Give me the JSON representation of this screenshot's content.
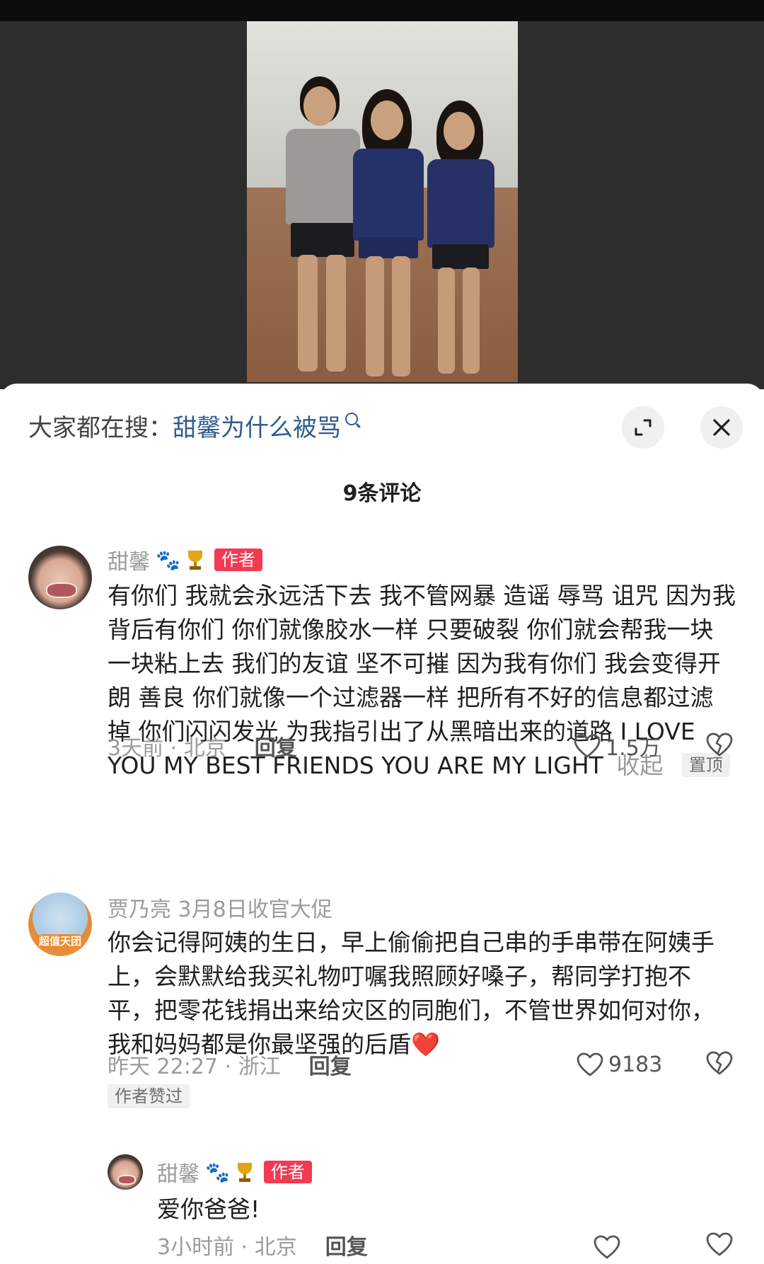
{
  "search": {
    "prefix": "大家都在搜：",
    "query": "甜馨为什么被骂"
  },
  "comment_count": "9条评论",
  "comments": [
    {
      "username": "甜馨",
      "paw": "🐾",
      "author_tag": "作者",
      "text": "有你们 我就会永远活下去 我不管网暴 造谣 辱骂 诅咒 因为我背后有你们 你们就像胶水一样 只要破裂 你们就会帮我一块一块粘上去 我们的友谊 坚不可摧 因为我有你们 我会变得开朗 善良 你们就像一个过滤器一样 把所有不好的信息都过滤掉 你们闪闪发光 为我指引出了从黑暗出来的道路 I LOVE YOU MY BEST FRIENDS YOU ARE MY LIGHT",
      "collapse": "收起",
      "pinned": "置顶",
      "time_location": "3天前 · 北京",
      "reply": "回复",
      "likes": "1.5万"
    },
    {
      "username": "贾乃亮 3月8日收官大促",
      "avatar_badge": "超值天团",
      "text": "你会记得阿姨的生日，早上偷偷把自己串的手串带在阿姨手上，会默默给我买礼物叮嘱我照顾好嗓子，帮同学打抱不平，把零花钱捐出来给灾区的同胞们，不管世界如何对你，我和妈妈都是你最坚强的后盾❤️",
      "time_location": "昨天 22:27 · 浙江",
      "reply": "回复",
      "likes": "9183",
      "liked_tag": "作者赞过"
    }
  ],
  "reply": {
    "username": "甜馨",
    "paw": "🐾",
    "author_tag": "作者",
    "text": "爱你爸爸!",
    "time_location": "3小时前 · 北京",
    "reply": "回复"
  },
  "colors": {
    "link": "#2f5d8c",
    "author_tag": "#f23a52",
    "heart": "#e8283c"
  }
}
